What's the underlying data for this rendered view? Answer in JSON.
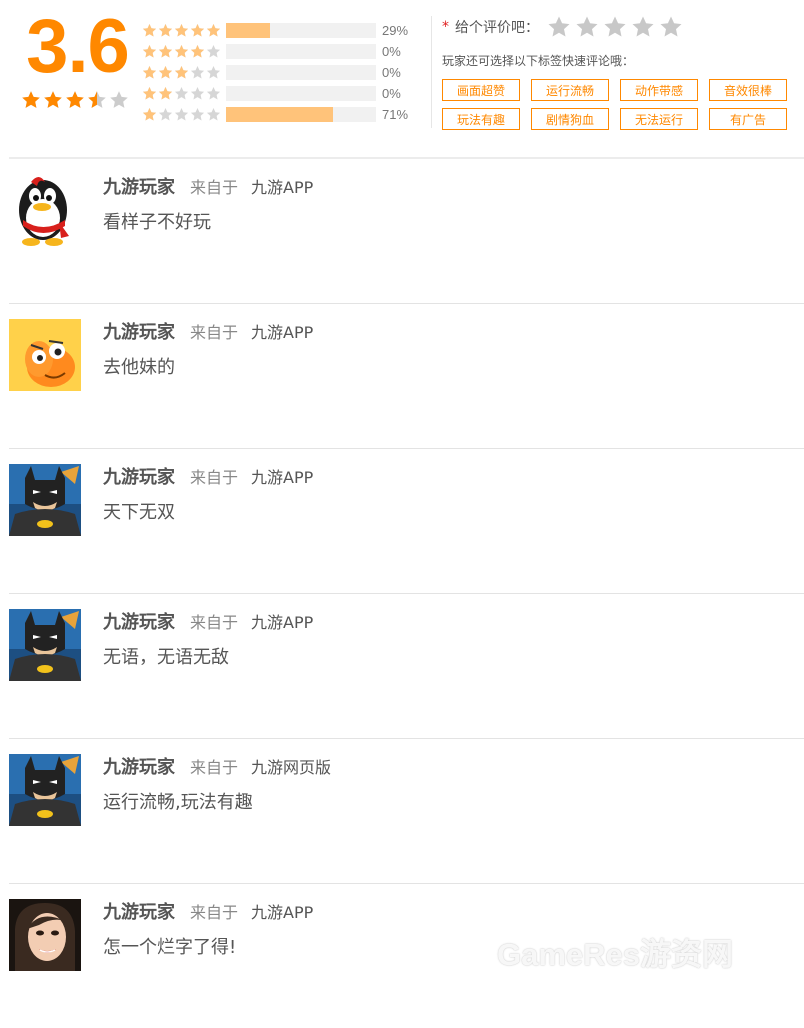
{
  "rating": {
    "score": "3.6",
    "score_value": 3.6,
    "distribution": [
      {
        "stars": 5,
        "percent_label": "29%",
        "fraction": 0.29
      },
      {
        "stars": 4,
        "percent_label": "0%",
        "fraction": 0
      },
      {
        "stars": 3,
        "percent_label": "0%",
        "fraction": 0
      },
      {
        "stars": 2,
        "percent_label": "0%",
        "fraction": 0
      },
      {
        "stars": 1,
        "percent_label": "71%",
        "fraction": 0.71
      }
    ]
  },
  "rate": {
    "required_mark": "*",
    "prompt": "给个评价吧：",
    "tag_hint": "玩家还可选择以下标签快速评论哦：",
    "tags": [
      "画面超赞",
      "运行流畅",
      "动作带感",
      "音效很棒",
      "玩法有趣",
      "剧情狗血",
      "无法运行",
      "有广告"
    ]
  },
  "comments": [
    {
      "user": "九游玩家",
      "from_label": "来自于",
      "source": "九游APP",
      "text": "看样子不好玩",
      "avatar": "penguin-avatar"
    },
    {
      "user": "九游玩家",
      "from_label": "来自于",
      "source": "九游APP",
      "text": "去他妹的",
      "avatar": "cartoon-face-avatar"
    },
    {
      "user": "九游玩家",
      "from_label": "来自于",
      "source": "九游APP",
      "text": "天下无双",
      "avatar": "batman-avatar"
    },
    {
      "user": "九游玩家",
      "from_label": "来自于",
      "source": "九游APP",
      "text": "无语，无语无敌",
      "avatar": "batman-avatar"
    },
    {
      "user": "九游玩家",
      "from_label": "来自于",
      "source": "九游网页版",
      "text": "运行流畅,玩法有趣",
      "avatar": "batman-avatar"
    },
    {
      "user": "九游玩家",
      "from_label": "来自于",
      "source": "九游APP",
      "text": "怎一个烂字了得!",
      "avatar": "woman-photo-avatar"
    }
  ],
  "watermark": "GameRes游资网",
  "colors": {
    "accent": "#ff8800",
    "bar_fill": "#ffc37a",
    "star_empty": "#cccccc",
    "star_filled": "#ff8800"
  }
}
